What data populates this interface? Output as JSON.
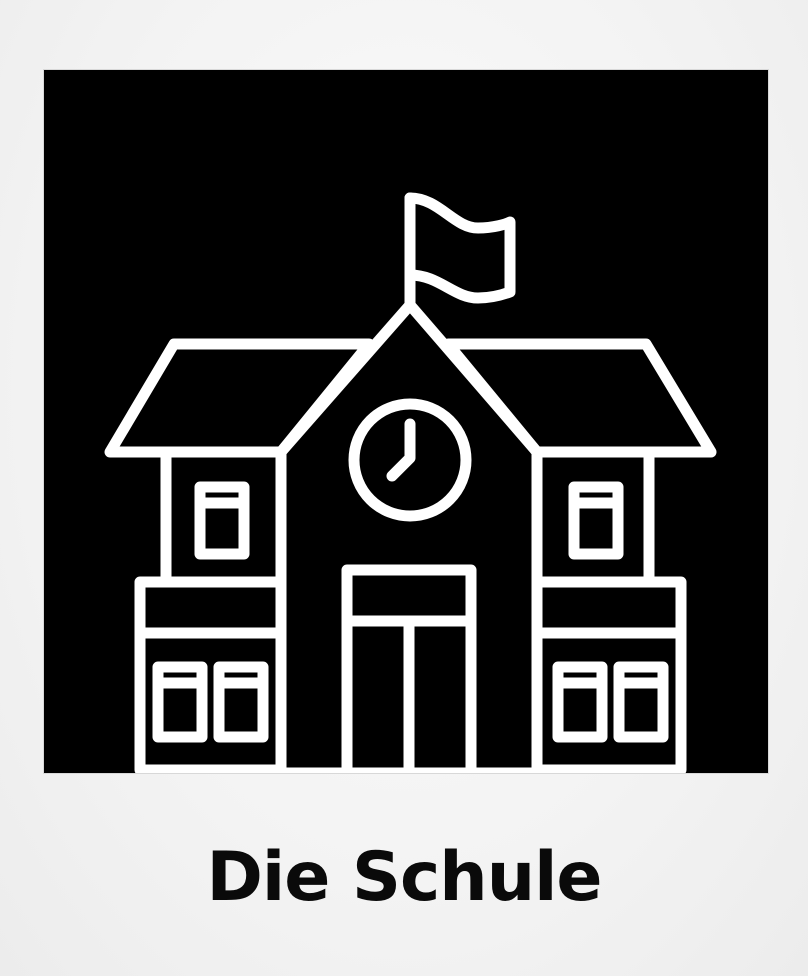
{
  "card": {
    "caption": "Die Schule"
  },
  "illustration": {
    "subject_icon": "school-building-icon",
    "background_color": "#000000",
    "line_color": "#ffffff"
  }
}
